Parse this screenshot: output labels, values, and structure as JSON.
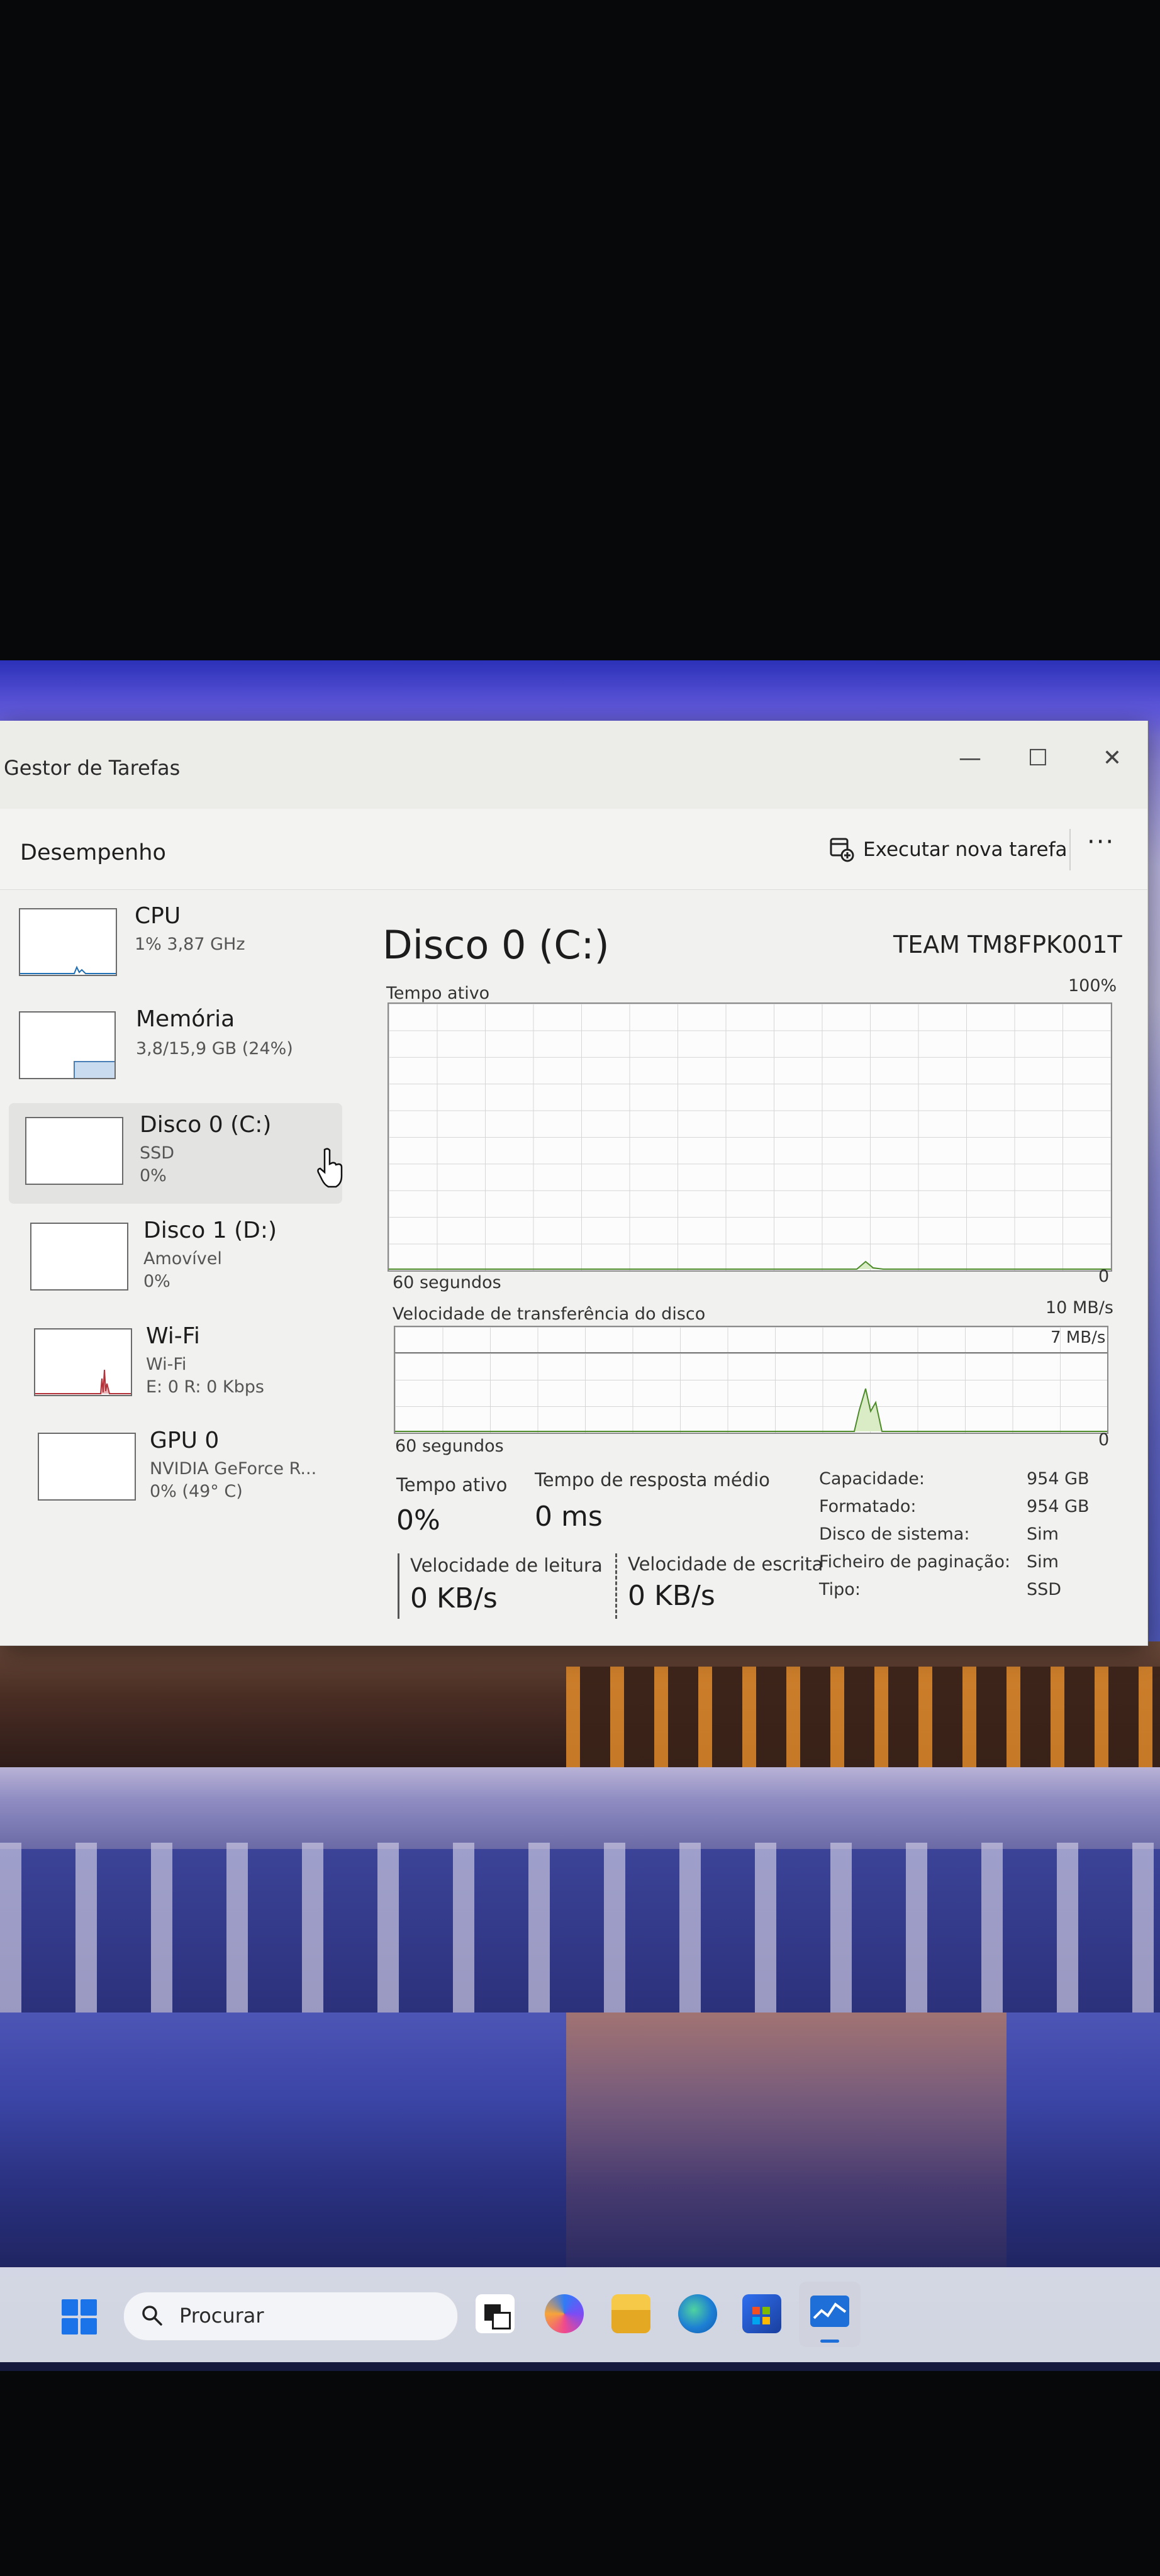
{
  "window": {
    "app_title": "Gestor de Tarefas",
    "controls": {
      "minimize": "—",
      "maximize": "☐",
      "close": "✕"
    }
  },
  "header": {
    "page_title": "Desempenho",
    "run_new_task_label": "Executar nova tarefa",
    "more_label": "···"
  },
  "sidebar": {
    "items": [
      {
        "name": "CPU",
        "line1": "1% 3,87 GHz",
        "line2": ""
      },
      {
        "name": "Memória",
        "line1": "3,8/15,9 GB (24%)",
        "line2": ""
      },
      {
        "name": "Disco 0 (C:)",
        "line1": "SSD",
        "line2": "0%"
      },
      {
        "name": "Disco 1 (D:)",
        "line1": "Amovível",
        "line2": "0%"
      },
      {
        "name": "Wi-Fi",
        "line1": "Wi-Fi",
        "line2": "E: 0 R: 0 Kbps"
      },
      {
        "name": "GPU 0",
        "line1": "NVIDIA GeForce R...",
        "line2": "0% (49° C)"
      }
    ],
    "selected_index": 2,
    "memory_used_fraction": 0.24
  },
  "main": {
    "disk_title": "Disco 0 (C:)",
    "model": "TEAM TM8FPK001T",
    "graph1": {
      "label": "Tempo ativo",
      "max_label": "100%",
      "time_label": "60 segundos",
      "min_label": "0"
    },
    "graph2": {
      "label": "Velocidade de transferência do disco",
      "max_label": "10 MB/s",
      "line_label": "7 MB/s",
      "time_label": "60 segundos",
      "min_label": "0"
    },
    "stats": {
      "active_time_label": "Tempo ativo",
      "active_time_value": "0%",
      "response_label": "Tempo de resposta médio",
      "response_value": "0 ms",
      "read_label": "Velocidade de leitura",
      "read_value": "0 KB/s",
      "write_label": "Velocidade de escrita",
      "write_value": "0 KB/s"
    },
    "properties": [
      {
        "label": "Capacidade:",
        "value": "954 GB"
      },
      {
        "label": "Formatado:",
        "value": "954 GB"
      },
      {
        "label": "Disco de sistema:",
        "value": "Sim"
      },
      {
        "label": "Ficheiro de paginação:",
        "value": "Sim"
      },
      {
        "label": "Tipo:",
        "value": "SSD"
      }
    ]
  },
  "taskbar": {
    "search_placeholder": "Procurar"
  },
  "colors": {
    "disk_accent": "#4d8a2a",
    "disk_fill": "#d9ecc6",
    "cpu_accent": "#1f6fb5",
    "wifi_accent": "#b3323a"
  }
}
